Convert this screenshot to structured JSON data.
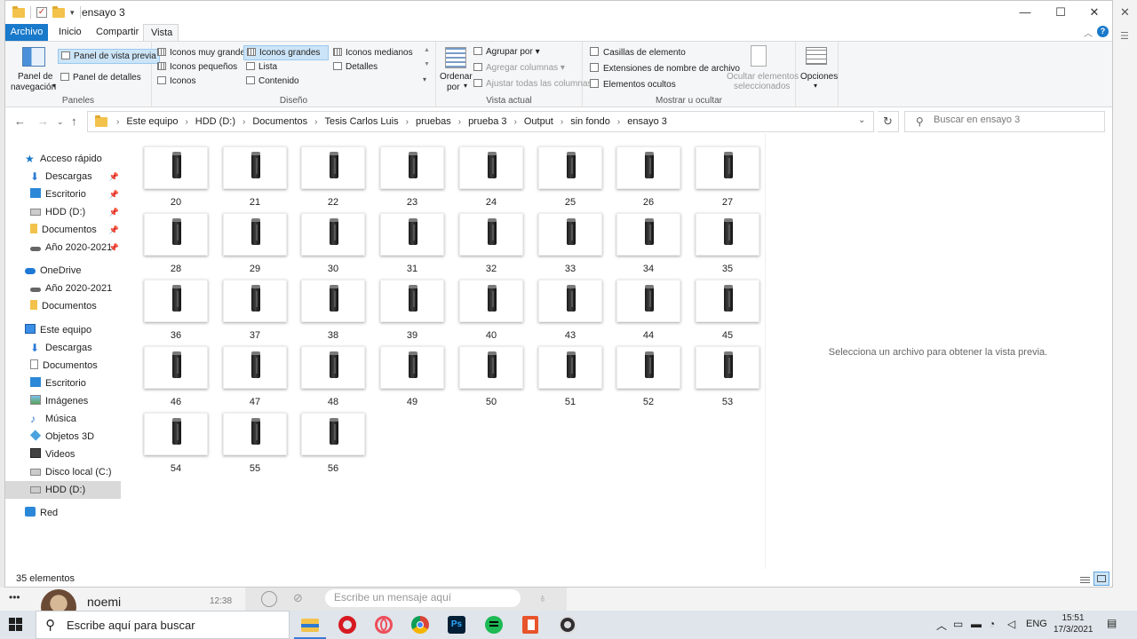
{
  "window": {
    "title": "ensayo 3"
  },
  "tabs": {
    "file": "Archivo",
    "home": "Inicio",
    "share": "Compartir",
    "view": "Vista"
  },
  "ribbon": {
    "panes": {
      "nav_pane_line1": "Panel de",
      "nav_pane_line2": "navegación",
      "preview_pane": "Panel de vista previa",
      "details_pane": "Panel de detalles",
      "label": "Paneles"
    },
    "layout": {
      "extra_large": "Iconos muy grandes",
      "large": "Iconos grandes",
      "medium": "Iconos medianos",
      "small": "Iconos pequeños",
      "list": "Lista",
      "details": "Detalles",
      "icons": "Iconos",
      "content": "Contenido",
      "label": "Diseño"
    },
    "current_view": {
      "sort_line1": "Ordenar",
      "sort_line2": "por",
      "group_by": "Agrupar por",
      "add_columns": "Agregar columnas",
      "fit_columns": "Ajustar todas las columnas",
      "label": "Vista actual"
    },
    "show_hide": {
      "item_checkboxes": "Casillas de elemento",
      "file_extensions": "Extensiones de nombre de archivo",
      "hidden_items": "Elementos ocultos",
      "hide_selected_line1": "Ocultar elementos",
      "hide_selected_line2": "seleccionados",
      "label": "Mostrar u ocultar"
    },
    "options": "Opciones"
  },
  "address": {
    "crumbs": [
      "Este equipo",
      "HDD (D:)",
      "Documentos",
      "Tesis Carlos Luis",
      "pruebas",
      "prueba 3",
      "Output",
      "sin fondo",
      "ensayo 3"
    ],
    "search_placeholder": "Buscar en ensayo 3"
  },
  "nav": {
    "quick_access": "Acceso rápido",
    "qa_downloads": "Descargas",
    "qa_desktop": "Escritorio",
    "qa_hdd": "HDD (D:)",
    "qa_documents": "Documentos",
    "qa_year": "Año 2020-2021",
    "onedrive": "OneDrive",
    "od_year": "Año 2020-2021",
    "od_documents": "Documentos",
    "this_pc": "Este equipo",
    "pc_downloads": "Descargas",
    "pc_documents": "Documentos",
    "pc_desktop": "Escritorio",
    "pc_images": "Imágenes",
    "pc_music": "Música",
    "pc_3d": "Objetos 3D",
    "pc_videos": "Videos",
    "pc_local": "Disco local (C:)",
    "pc_hdd": "HDD (D:)",
    "network": "Red"
  },
  "files": [
    "20",
    "21",
    "22",
    "23",
    "24",
    "25",
    "26",
    "27",
    "28",
    "29",
    "30",
    "31",
    "32",
    "33",
    "34",
    "35",
    "36",
    "37",
    "38",
    "39",
    "40",
    "43",
    "44",
    "45",
    "46",
    "47",
    "48",
    "49",
    "50",
    "51",
    "52",
    "53",
    "54",
    "55",
    "56"
  ],
  "preview_message": "Selecciona un archivo para obtener la vista previa.",
  "status": {
    "count": "35 elementos"
  },
  "background_app": {
    "contact": "noemi",
    "time": "12:38",
    "message_placeholder": "Escribe un mensaje aquí"
  },
  "taskbar": {
    "search": "Escribe aquí para buscar",
    "lang": "ENG",
    "time": "15:51",
    "date": "17/3/2021"
  },
  "colors": {
    "accent": "#1979ca",
    "selection": "#cce4f7"
  }
}
